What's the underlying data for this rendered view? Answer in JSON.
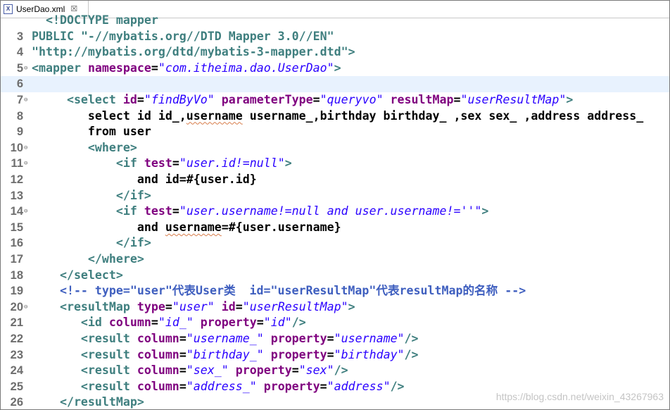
{
  "tab": {
    "title": "UserDao.xml",
    "icon": "xml-file-icon",
    "close_glyph": "☒"
  },
  "watermark": "https://blog.csdn.net/weixin_43267963",
  "lines": [
    {
      "n": "",
      "fold": false,
      "tokens": [
        {
          "t": "  <!DOCTYPE mapper",
          "c": "c-tag"
        }
      ]
    },
    {
      "n": "3",
      "fold": false,
      "tokens": [
        {
          "t": "PUBLIC ",
          "c": "c-tag"
        },
        {
          "t": "\"-//mybatis.org//DTD Mapper 3.0//EN\"",
          "c": "c-tag"
        }
      ]
    },
    {
      "n": "4",
      "fold": false,
      "tokens": [
        {
          "t": "\"http://mybatis.org/dtd/mybatis-3-mapper.dtd\">",
          "c": "c-tag"
        }
      ]
    },
    {
      "n": "5",
      "fold": true,
      "tokens": [
        {
          "t": "<mapper ",
          "c": "c-tag"
        },
        {
          "t": "namespace",
          "c": "c-attr"
        },
        {
          "t": "=",
          "c": "c-text"
        },
        {
          "t": "\"com.itheima.dao.UserDao\"",
          "c": "c-val"
        },
        {
          "t": ">",
          "c": "c-tag"
        }
      ]
    },
    {
      "n": "6",
      "fold": false,
      "current": true,
      "tokens": []
    },
    {
      "n": "7",
      "fold": true,
      "tokens": [
        {
          "t": "     <select ",
          "c": "c-tag"
        },
        {
          "t": "id",
          "c": "c-attr"
        },
        {
          "t": "=",
          "c": "c-text"
        },
        {
          "t": "\"findByVo\"",
          "c": "c-val"
        },
        {
          "t": " parameterType",
          "c": "c-attr"
        },
        {
          "t": "=",
          "c": "c-text"
        },
        {
          "t": "\"queryvo\"",
          "c": "c-val"
        },
        {
          "t": " resultMap",
          "c": "c-attr"
        },
        {
          "t": "=",
          "c": "c-text"
        },
        {
          "t": "\"userResultMap\"",
          "c": "c-val"
        },
        {
          "t": ">",
          "c": "c-tag"
        }
      ]
    },
    {
      "n": "8",
      "fold": false,
      "tokens": [
        {
          "t": "        select id id_,",
          "c": "c-text"
        },
        {
          "t": "username",
          "c": "c-text squiggle"
        },
        {
          "t": " username_,birthday birthday_ ,sex sex_ ,address address_",
          "c": "c-text"
        }
      ]
    },
    {
      "n": "9",
      "fold": false,
      "tokens": [
        {
          "t": "        from user",
          "c": "c-text"
        }
      ]
    },
    {
      "n": "10",
      "fold": true,
      "tokens": [
        {
          "t": "        <where>",
          "c": "c-tag"
        }
      ]
    },
    {
      "n": "11",
      "fold": true,
      "tokens": [
        {
          "t": "            <if ",
          "c": "c-tag"
        },
        {
          "t": "test",
          "c": "c-attr"
        },
        {
          "t": "=",
          "c": "c-text"
        },
        {
          "t": "\"user.id!=null\"",
          "c": "c-val"
        },
        {
          "t": ">",
          "c": "c-tag"
        }
      ]
    },
    {
      "n": "12",
      "fold": false,
      "tokens": [
        {
          "t": "               and id=#{user.id}",
          "c": "c-text"
        }
      ]
    },
    {
      "n": "13",
      "fold": false,
      "tokens": [
        {
          "t": "            </if>",
          "c": "c-tag"
        }
      ]
    },
    {
      "n": "14",
      "fold": true,
      "tokens": [
        {
          "t": "            <if ",
          "c": "c-tag"
        },
        {
          "t": "test",
          "c": "c-attr"
        },
        {
          "t": "=",
          "c": "c-text"
        },
        {
          "t": "\"user.username!=null and user.username!=''\"",
          "c": "c-val"
        },
        {
          "t": ">",
          "c": "c-tag"
        }
      ]
    },
    {
      "n": "15",
      "fold": false,
      "tokens": [
        {
          "t": "               and ",
          "c": "c-text"
        },
        {
          "t": "username",
          "c": "c-text squiggle"
        },
        {
          "t": "=#{user.username}",
          "c": "c-text"
        }
      ]
    },
    {
      "n": "16",
      "fold": false,
      "tokens": [
        {
          "t": "            </if>",
          "c": "c-tag"
        }
      ]
    },
    {
      "n": "17",
      "fold": false,
      "tokens": [
        {
          "t": "        </where>",
          "c": "c-tag"
        }
      ]
    },
    {
      "n": "18",
      "fold": false,
      "tokens": [
        {
          "t": "    </select>",
          "c": "c-tag"
        }
      ]
    },
    {
      "n": "19",
      "fold": false,
      "tokens": [
        {
          "t": "    <!-- type=\"user\"代表User类  id=\"userResultMap\"代表resultMap的名称 -->",
          "c": "c-cmt"
        }
      ]
    },
    {
      "n": "20",
      "fold": true,
      "tokens": [
        {
          "t": "    <resultMap ",
          "c": "c-tag"
        },
        {
          "t": "type",
          "c": "c-attr"
        },
        {
          "t": "=",
          "c": "c-text"
        },
        {
          "t": "\"user\"",
          "c": "c-val"
        },
        {
          "t": " id",
          "c": "c-attr"
        },
        {
          "t": "=",
          "c": "c-text"
        },
        {
          "t": "\"userResultMap\"",
          "c": "c-val"
        },
        {
          "t": ">",
          "c": "c-tag"
        }
      ]
    },
    {
      "n": "21",
      "fold": false,
      "tokens": [
        {
          "t": "       <id ",
          "c": "c-tag"
        },
        {
          "t": "column",
          "c": "c-attr"
        },
        {
          "t": "=",
          "c": "c-text"
        },
        {
          "t": "\"id_\"",
          "c": "c-val"
        },
        {
          "t": " property",
          "c": "c-attr"
        },
        {
          "t": "=",
          "c": "c-text"
        },
        {
          "t": "\"id\"",
          "c": "c-val"
        },
        {
          "t": "/>",
          "c": "c-tag"
        }
      ]
    },
    {
      "n": "22",
      "fold": false,
      "tokens": [
        {
          "t": "       <result ",
          "c": "c-tag"
        },
        {
          "t": "column",
          "c": "c-attr"
        },
        {
          "t": "=",
          "c": "c-text"
        },
        {
          "t": "\"username_\"",
          "c": "c-val"
        },
        {
          "t": " property",
          "c": "c-attr"
        },
        {
          "t": "=",
          "c": "c-text"
        },
        {
          "t": "\"username\"",
          "c": "c-val"
        },
        {
          "t": "/>",
          "c": "c-tag"
        }
      ]
    },
    {
      "n": "23",
      "fold": false,
      "tokens": [
        {
          "t": "       <result ",
          "c": "c-tag"
        },
        {
          "t": "column",
          "c": "c-attr"
        },
        {
          "t": "=",
          "c": "c-text"
        },
        {
          "t": "\"birthday_\"",
          "c": "c-val"
        },
        {
          "t": " property",
          "c": "c-attr"
        },
        {
          "t": "=",
          "c": "c-text"
        },
        {
          "t": "\"birthday\"",
          "c": "c-val"
        },
        {
          "t": "/>",
          "c": "c-tag"
        }
      ]
    },
    {
      "n": "24",
      "fold": false,
      "tokens": [
        {
          "t": "       <result ",
          "c": "c-tag"
        },
        {
          "t": "column",
          "c": "c-attr"
        },
        {
          "t": "=",
          "c": "c-text"
        },
        {
          "t": "\"sex_\"",
          "c": "c-val"
        },
        {
          "t": " property",
          "c": "c-attr"
        },
        {
          "t": "=",
          "c": "c-text"
        },
        {
          "t": "\"sex\"",
          "c": "c-val"
        },
        {
          "t": "/>",
          "c": "c-tag"
        }
      ]
    },
    {
      "n": "25",
      "fold": false,
      "tokens": [
        {
          "t": "       <result ",
          "c": "c-tag"
        },
        {
          "t": "column",
          "c": "c-attr"
        },
        {
          "t": "=",
          "c": "c-text"
        },
        {
          "t": "\"address_\"",
          "c": "c-val"
        },
        {
          "t": " property",
          "c": "c-attr"
        },
        {
          "t": "=",
          "c": "c-text"
        },
        {
          "t": "\"address\"",
          "c": "c-val"
        },
        {
          "t": "/>",
          "c": "c-tag"
        }
      ]
    },
    {
      "n": "26",
      "fold": false,
      "tokens": [
        {
          "t": "    </resultMap>",
          "c": "c-tag"
        }
      ]
    }
  ]
}
